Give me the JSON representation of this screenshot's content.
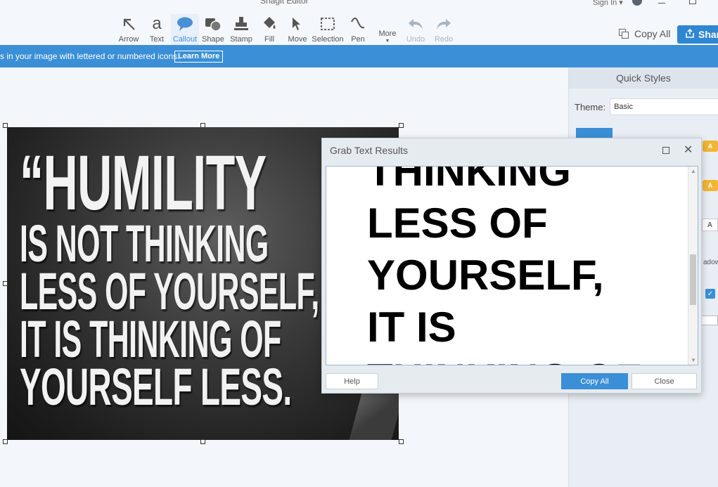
{
  "app": {
    "title": "Snagit Editor",
    "sign_in": "Sign In ▾"
  },
  "toolbar": {
    "tools": [
      {
        "label": "Arrow",
        "icon": "arrow-icon"
      },
      {
        "label": "Text",
        "icon": "text-icon"
      },
      {
        "label": "Callout",
        "icon": "callout-icon",
        "active": true
      },
      {
        "label": "Shape",
        "icon": "shape-icon"
      },
      {
        "label": "Stamp",
        "icon": "stamp-icon"
      },
      {
        "label": "Fill",
        "icon": "fill-icon"
      },
      {
        "label": "Move",
        "icon": "move-icon"
      },
      {
        "label": "Selection",
        "icon": "selection-icon"
      },
      {
        "label": "Pen",
        "icon": "pen-icon"
      },
      {
        "label": "More",
        "icon": "more-icon"
      },
      {
        "label": "Undo",
        "icon": "undo-icon",
        "disabled": true
      },
      {
        "label": "Redo",
        "icon": "redo-icon",
        "disabled": true
      }
    ],
    "copy_all": "Copy All",
    "share": "Share"
  },
  "banner": {
    "text": "s in your image with lettered or numbered icons.",
    "learn_more": "Learn More"
  },
  "panel": {
    "title": "Quick Styles",
    "theme_label": "Theme:",
    "theme_value": "Basic",
    "callout_letter": "A",
    "shadow_label": "adow"
  },
  "image": {
    "quote_lines": [
      "“HUMILITY",
      "IS NOT THINKING",
      "LESS OF YOURSELF,",
      "IT IS THINKING OF",
      "YOURSELF LESS."
    ]
  },
  "dialog": {
    "title": "Grab Text Results",
    "text_lines": [
      "THINKING",
      "LESS OF",
      "YOURSELF,",
      "IT IS",
      "THINKING OF"
    ],
    "help": "Help",
    "copy_all": "Copy All",
    "close": "Close"
  },
  "colors": {
    "accent": "#3b8fd6",
    "callout_orange": "#f2b634"
  }
}
